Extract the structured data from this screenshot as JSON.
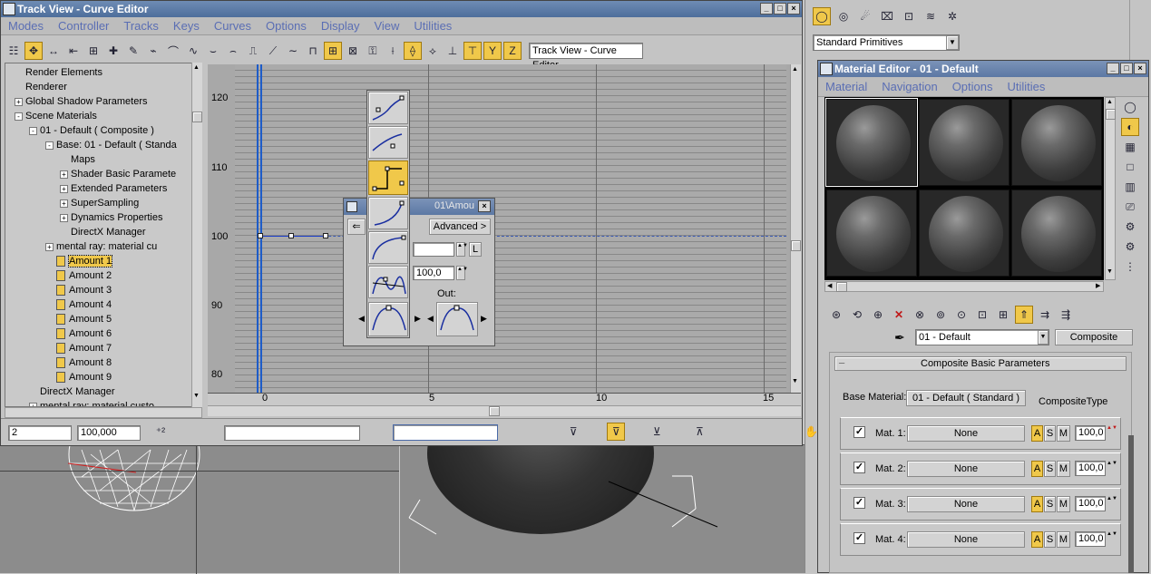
{
  "track_view": {
    "title": "Track View - Curve Editor",
    "menu": [
      "Modes",
      "Controller",
      "Tracks",
      "Keys",
      "Curves",
      "Options",
      "Display",
      "View",
      "Utilities"
    ],
    "name_field": "Track View - Curve Editor",
    "tree": [
      {
        "label": "Render Elements",
        "indent": 0,
        "box": ""
      },
      {
        "label": "Renderer",
        "indent": 0,
        "box": ""
      },
      {
        "label": "Global Shadow Parameters",
        "indent": 0,
        "box": "+"
      },
      {
        "label": "Scene Materials",
        "indent": 0,
        "box": "-"
      },
      {
        "label": "01 - Default  ( Composite )",
        "indent": 1,
        "box": "-"
      },
      {
        "label": "Base: 01 - Default  ( Standa",
        "indent": 2,
        "box": "-"
      },
      {
        "label": "Maps",
        "indent": 3,
        "box": ""
      },
      {
        "label": "Shader Basic Paramete",
        "indent": 3,
        "box": "+"
      },
      {
        "label": "Extended Parameters",
        "indent": 3,
        "box": "+"
      },
      {
        "label": "SuperSampling",
        "indent": 3,
        "box": "+"
      },
      {
        "label": "Dynamics Properties",
        "indent": 3,
        "box": "+"
      },
      {
        "label": "DirectX Manager",
        "indent": 3,
        "box": ""
      },
      {
        "label": "mental ray: material cu",
        "indent": 2,
        "box": "+"
      },
      {
        "label": "Amount 1",
        "indent": 2,
        "box": "",
        "selected": true
      },
      {
        "label": "Amount 2",
        "indent": 2,
        "box": ""
      },
      {
        "label": "Amount 3",
        "indent": 2,
        "box": ""
      },
      {
        "label": "Amount 4",
        "indent": 2,
        "box": ""
      },
      {
        "label": "Amount 5",
        "indent": 2,
        "box": ""
      },
      {
        "label": "Amount 6",
        "indent": 2,
        "box": ""
      },
      {
        "label": "Amount 7",
        "indent": 2,
        "box": ""
      },
      {
        "label": "Amount 8",
        "indent": 2,
        "box": ""
      },
      {
        "label": "Amount 9",
        "indent": 2,
        "box": ""
      },
      {
        "label": "DirectX Manager",
        "indent": 1,
        "box": ""
      },
      {
        "label": "mental ray: material custo",
        "indent": 1,
        "box": "+"
      }
    ],
    "y_ticks": [
      "120",
      "110",
      "100",
      "90",
      "80"
    ],
    "x_ticks": [
      "0",
      "5",
      "10",
      "15"
    ],
    "status": {
      "frame": "2",
      "value": "100,000"
    }
  },
  "key_dialog": {
    "title_frag": "01\\Amou",
    "advanced_label": "Advanced >",
    "value": "100,0",
    "l_label": "L",
    "out_label": "Out:"
  },
  "main_panel": {
    "dropdown": "Standard Primitives"
  },
  "material_editor": {
    "title": "Material Editor - 01 - Default",
    "menu": [
      "Material",
      "Navigation",
      "Options",
      "Utilities"
    ],
    "material_name": "01 - Default",
    "material_type": "Composite",
    "rollout_title": "Composite Basic Parameters",
    "base_material_label": "Base Material:",
    "base_material_value": "01 - Default  ( Standard )",
    "composite_type_label": "CompositeType",
    "rows": [
      {
        "label": "Mat. 1:",
        "value": "None",
        "amount": "100,0"
      },
      {
        "label": "Mat. 2:",
        "value": "None",
        "amount": "100,0"
      },
      {
        "label": "Mat. 3:",
        "value": "None",
        "amount": "100,0"
      },
      {
        "label": "Mat. 4:",
        "value": "None",
        "amount": "100,0"
      }
    ],
    "a_label": "A",
    "s_label": "S",
    "m_label": "M",
    "collapse_label": "_"
  }
}
